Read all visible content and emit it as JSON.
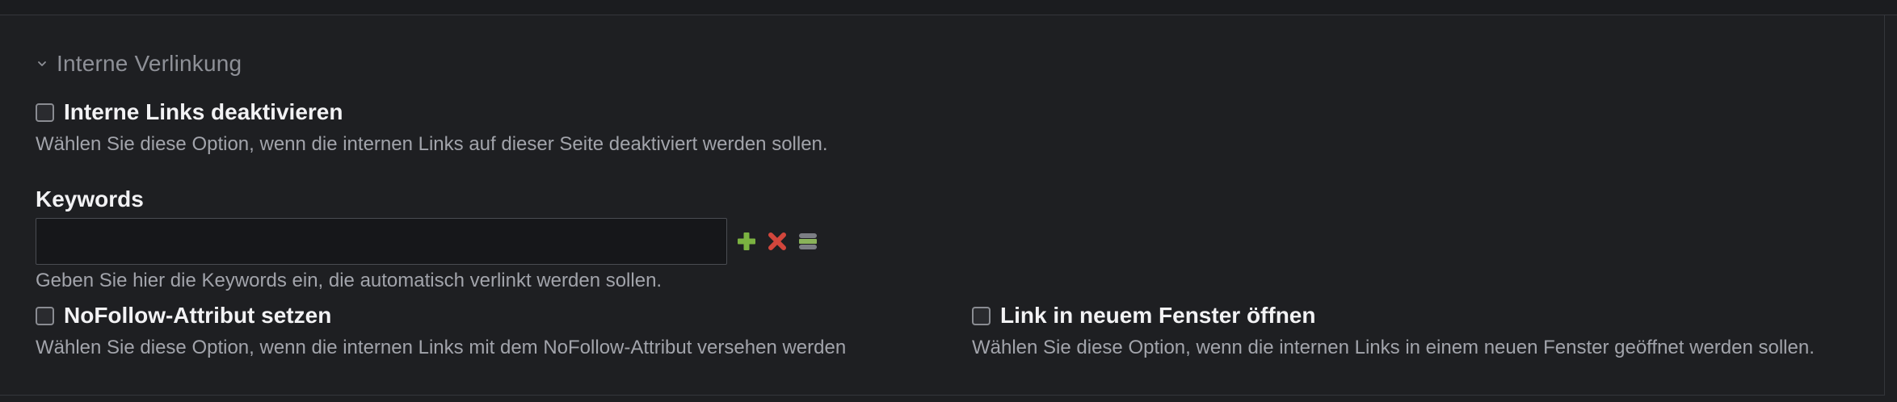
{
  "section": {
    "title": "Interne Verlinkung",
    "icon": "chevron-down-icon"
  },
  "disable_links": {
    "label": "Interne Links deaktivieren",
    "help": "Wählen Sie diese Option, wenn die internen Links auf dieser Seite deaktiviert werden sollen.",
    "checked": false
  },
  "keywords": {
    "label": "Keywords",
    "value": "",
    "help": "Geben Sie hier die Keywords ein, die automatisch verlinkt werden sollen.",
    "actions": [
      {
        "name": "add",
        "icon": "plus-icon",
        "color": "#7bb241"
      },
      {
        "name": "remove",
        "icon": "x-icon",
        "color": "#d2463c"
      },
      {
        "name": "list",
        "icon": "stack-icon",
        "color": "#8ab35a"
      }
    ]
  },
  "nofollow": {
    "label": "NoFollow-Attribut setzen",
    "help": "Wählen Sie diese Option, wenn die internen Links mit dem NoFollow-Attribut versehen werden",
    "checked": false
  },
  "new_window": {
    "label": "Link in neuem Fenster öffnen",
    "help": "Wählen Sie diese Option, wenn die internen Links in einem neuen Fenster geöffnet werden sollen.",
    "checked": false
  },
  "colors": {
    "background": "#1e1f22",
    "border": "#34363b",
    "muted_text": "#a2a4ab",
    "title_text": "#8e9097"
  }
}
